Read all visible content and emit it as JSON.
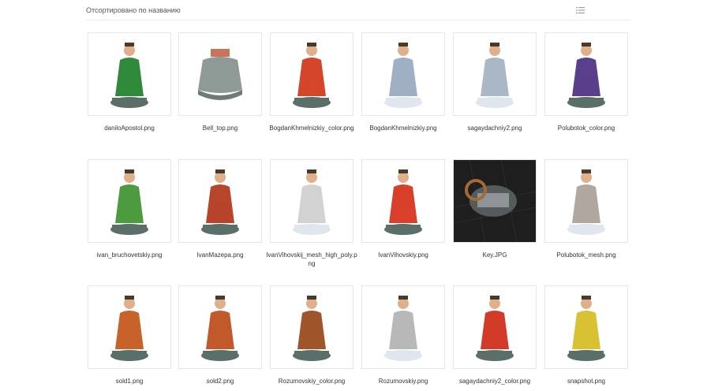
{
  "toolbar": {
    "sort_label": "Отсортировано по названию",
    "view_icon": "list-view-icon"
  },
  "files": [
    {
      "name": "daniloApostol.png",
      "figure": "man-green-coat",
      "coat": "#2f8a3c"
    },
    {
      "name": "Bell_top.png",
      "figure": "bell",
      "coat": "#8e9a96"
    },
    {
      "name": "BogdanKhmelnizkiy_color.png",
      "figure": "man-red-cape",
      "coat": "#d4462a"
    },
    {
      "name": "BogdanKhmelnizkiy.png",
      "figure": "man-gray-mesh",
      "coat": "#9fb0c4"
    },
    {
      "name": "sagaydachniy2.png",
      "figure": "man-gray-mesh-small",
      "coat": "#a9b7c6"
    },
    {
      "name": "Polubotok_color.png",
      "figure": "man-purple-coat",
      "coat": "#5a3f8c"
    },
    {
      "name": "ivan_bruchovetskiy.png",
      "figure": "man-green-cape",
      "coat": "#4c9b3f"
    },
    {
      "name": "IvanMazepa.png",
      "figure": "man-red-scroll",
      "coat": "#b8442b"
    },
    {
      "name": "IvanVihovskij_mesh_high_poly.png",
      "figure": "man-white-mesh",
      "coat": "#d2d2d2"
    },
    {
      "name": "IvanVihovskiy.png",
      "figure": "man-red-yellow",
      "coat": "#d9402c"
    },
    {
      "name": "Key.JPG",
      "figure": "dark-render",
      "coat": "#3a3a3a"
    },
    {
      "name": "Polubotok_mesh.png",
      "figure": "man-gray-mesh-tall",
      "coat": "#b0a8a0"
    },
    {
      "name": "sold1.png",
      "figure": "soldier-orange",
      "coat": "#c9612a"
    },
    {
      "name": "sold2.png",
      "figure": "soldier-orange-2",
      "coat": "#c2592a"
    },
    {
      "name": "Rozumovskiy_color.png",
      "figure": "man-brown-coat",
      "coat": "#a0542a"
    },
    {
      "name": "Rozumovskiy.png",
      "figure": "man-gray-mesh-2",
      "coat": "#b8b8b8"
    },
    {
      "name": "sagaydachniy2_color.png",
      "figure": "man-red-hat",
      "coat": "#d23b2a"
    },
    {
      "name": "snapshot.png",
      "figure": "woman-yellow",
      "coat": "#d8c132"
    }
  ]
}
